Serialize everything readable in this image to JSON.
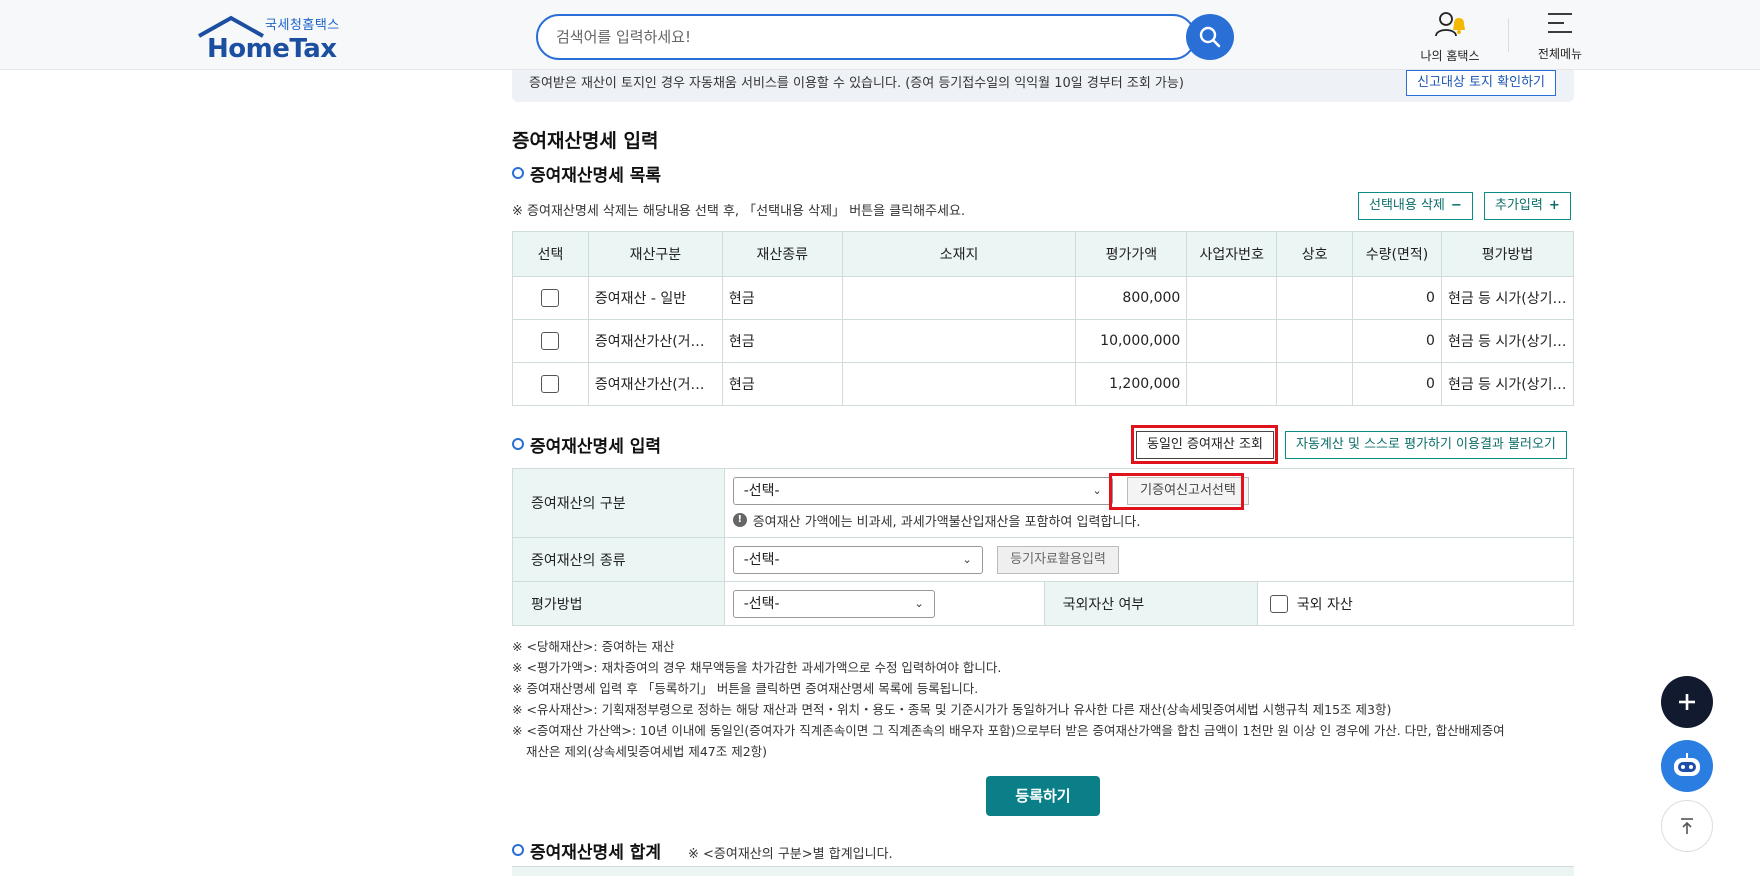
{
  "header": {
    "logo_sub": "국세청홈택스",
    "logo_main": "HomeTax",
    "search_placeholder": "검색어를 입력하세요!",
    "my_hometax": "나의 홈택스",
    "all_menu": "전체메뉴"
  },
  "notice": {
    "text": "증여받은 재산이 토지인 경우 자동채움 서비스를 이용할 수 있습니다. (증여 등기접수일의 익익월 10일 경부터 조회 가능)",
    "button": "신고대상 토지 확인하기"
  },
  "section_title": "증여재산명세 입력",
  "list": {
    "title": "증여재산명세 목록",
    "note": "※ 증여재산명세 삭제는 해당내용 선택 후, 「선택내용 삭제」 버튼을 클릭해주세요.",
    "delete_btn": "선택내용 삭제",
    "delete_sym": "−",
    "add_btn": "추가입력",
    "add_sym": "+",
    "headers": [
      "선택",
      "재산구분",
      "재산종류",
      "소재지",
      "평가가액",
      "사업자번호",
      "상호",
      "수량(면적)",
      "평가방법"
    ],
    "rows": [
      {
        "category": "증여재산 - 일반",
        "type": "현금",
        "location": "",
        "value": "800,000",
        "biz_no": "",
        "name": "",
        "qty": "0",
        "method": "현금 등 시가(상기…"
      },
      {
        "category": "증여재산가산(거…",
        "type": "현금",
        "location": "",
        "value": "10,000,000",
        "biz_no": "",
        "name": "",
        "qty": "0",
        "method": "현금 등 시가(상기…"
      },
      {
        "category": "증여재산가산(거…",
        "type": "현금",
        "location": "",
        "value": "1,200,000",
        "biz_no": "",
        "name": "",
        "qty": "0",
        "method": "현금 등 시가(상기…"
      }
    ]
  },
  "input": {
    "title": "증여재산명세 입력",
    "same_person_btn": "동일인 증여재산 조회",
    "auto_calc_btn": "자동계산 및 스스로 평가하기 이용결과 불러오기",
    "row1_label": "증여재산의 구분",
    "row1_select": "-선택-",
    "row1_btn": "기증여신고서선택",
    "row1_hint": "증여재산 가액에는 비과세, 과세가액불산입재산을 포함하여 입력합니다.",
    "row2_label": "증여재산의 종류",
    "row2_select": "-선택-",
    "row2_btn": "등기자료활용입력",
    "row3_label": "평가방법",
    "row3_select": "-선택-",
    "foreign_label": "국외자산 여부",
    "foreign_check": "국외 자산"
  },
  "notes": [
    "※ <당해재산>: 증여하는 재산",
    "※ <평가가액>: 재차증여의 경우 채무액등을 차가감한 과세가액으로 수정 입력하여야 합니다.",
    "※ 증여재산명세 입력 후 「등록하기」 버튼을 클릭하면 증여재산명세 목록에 등록됩니다.",
    "※ <유사재산>: 기획재정부령으로 정하는 해당 재산과 면적・위치・용도・종목 및 기준시가가 동일하거나 유사한 다른 재산(상속세및증여세법 시행규칙 제15조 제3항)",
    "※ <증여재산 가산액>: 10년 이내에 동일인(증여자가 직계존속이면 그 직계존속의 배우자 포함)으로부터 받은 증여재산가액을 합친 금액이 1천만 원 이상 인 경우에 가산. 다만, 합산배제증여",
    "재산은 제외(상속세및증여세법 제47조 제2항)"
  ],
  "submit": "등록하기",
  "summary": {
    "title": "증여재산명세 합계",
    "note": "※ <증여재산의 구분>별 합계입니다."
  },
  "colors": {
    "accent": "#2a6fd6",
    "teal": "#0b7f88",
    "highlight": "#e0121c"
  }
}
